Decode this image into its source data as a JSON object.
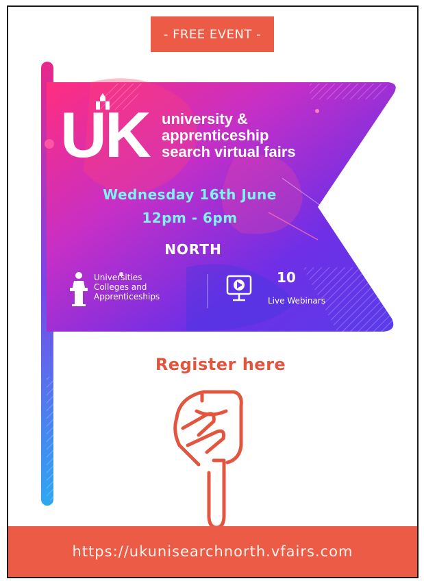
{
  "badge": {
    "label": "- FREE EVENT -"
  },
  "logo": {
    "letters": "UK"
  },
  "event": {
    "title_lines": [
      "university &",
      "apprenticeship",
      "search virtual fairs"
    ],
    "date": "Wednesday 16th June",
    "time": "12pm - 6pm",
    "region": "NORTH"
  },
  "features": {
    "exhibitors_lines": [
      "Universities",
      "Colleges and",
      "Apprenticeships"
    ],
    "webinars_count": "10",
    "webinars_label": "Live Webinars"
  },
  "cta": {
    "label": "Register here"
  },
  "footer": {
    "url": "https://ukunisearchnorth.vfairs.com"
  },
  "colors": {
    "accent": "#ec5b45",
    "flag_start": "#e8288a",
    "flag_end": "#5b2de0",
    "date_text": "#7ff2f4",
    "pole_bottom": "#2ea8f2"
  },
  "icons": [
    "speaker-podium-icon",
    "video-monitor-icon",
    "pointing-hand-icon"
  ]
}
